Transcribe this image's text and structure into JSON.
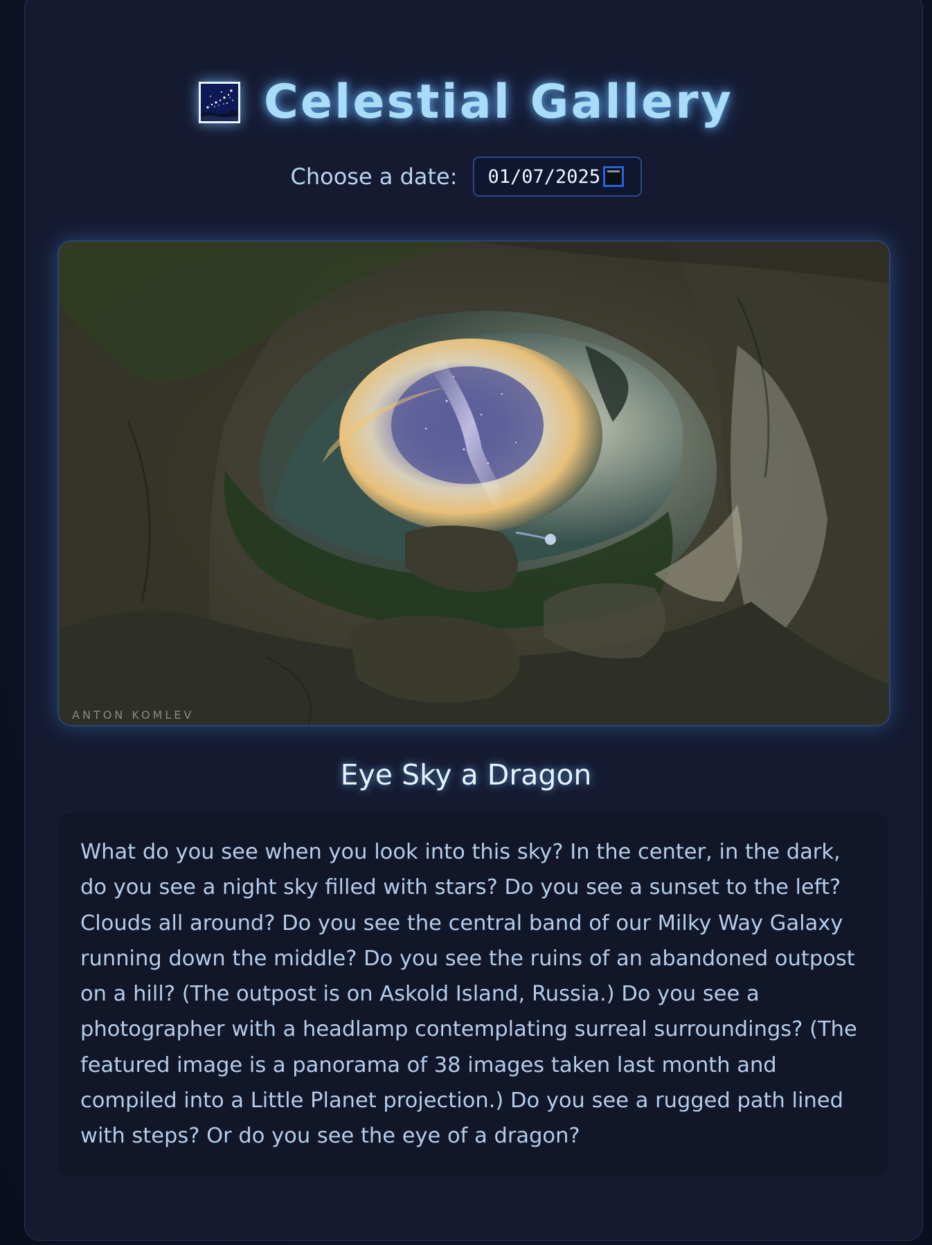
{
  "header": {
    "logo_icon": "night-sky-stars-icon",
    "title": "Celestial Gallery"
  },
  "date_picker": {
    "label": "Choose a date:",
    "value": "01/07/2025",
    "icon": "calendar-icon"
  },
  "photo": {
    "watermark": "ANTON KOMLEV",
    "title": "Eye Sky a Dragon"
  },
  "description": {
    "text": "What do you see when you look into this sky? In the center, in the dark, do you see a night sky filled with stars? Do you see a sunset to the left? Clouds all around? Do you see the central band of our Milky Way Galaxy running down the middle? Do you see the ruins of an abandoned outpost on a hill? (The outpost is on Askold Island, Russia.) Do you see a photographer with a headlamp contemplating surreal surroundings? (The featured image is a panorama of 38 images taken last month and compiled into a Little Planet projection.) Do you see a rugged path lined with steps? Or do you see the eye of a dragon?"
  },
  "colors": {
    "background": "#0c1122",
    "card": "#151a31",
    "title_glow": "#a9dcf8",
    "accent_border": "#2e4a86",
    "text": "#b5cdea"
  }
}
